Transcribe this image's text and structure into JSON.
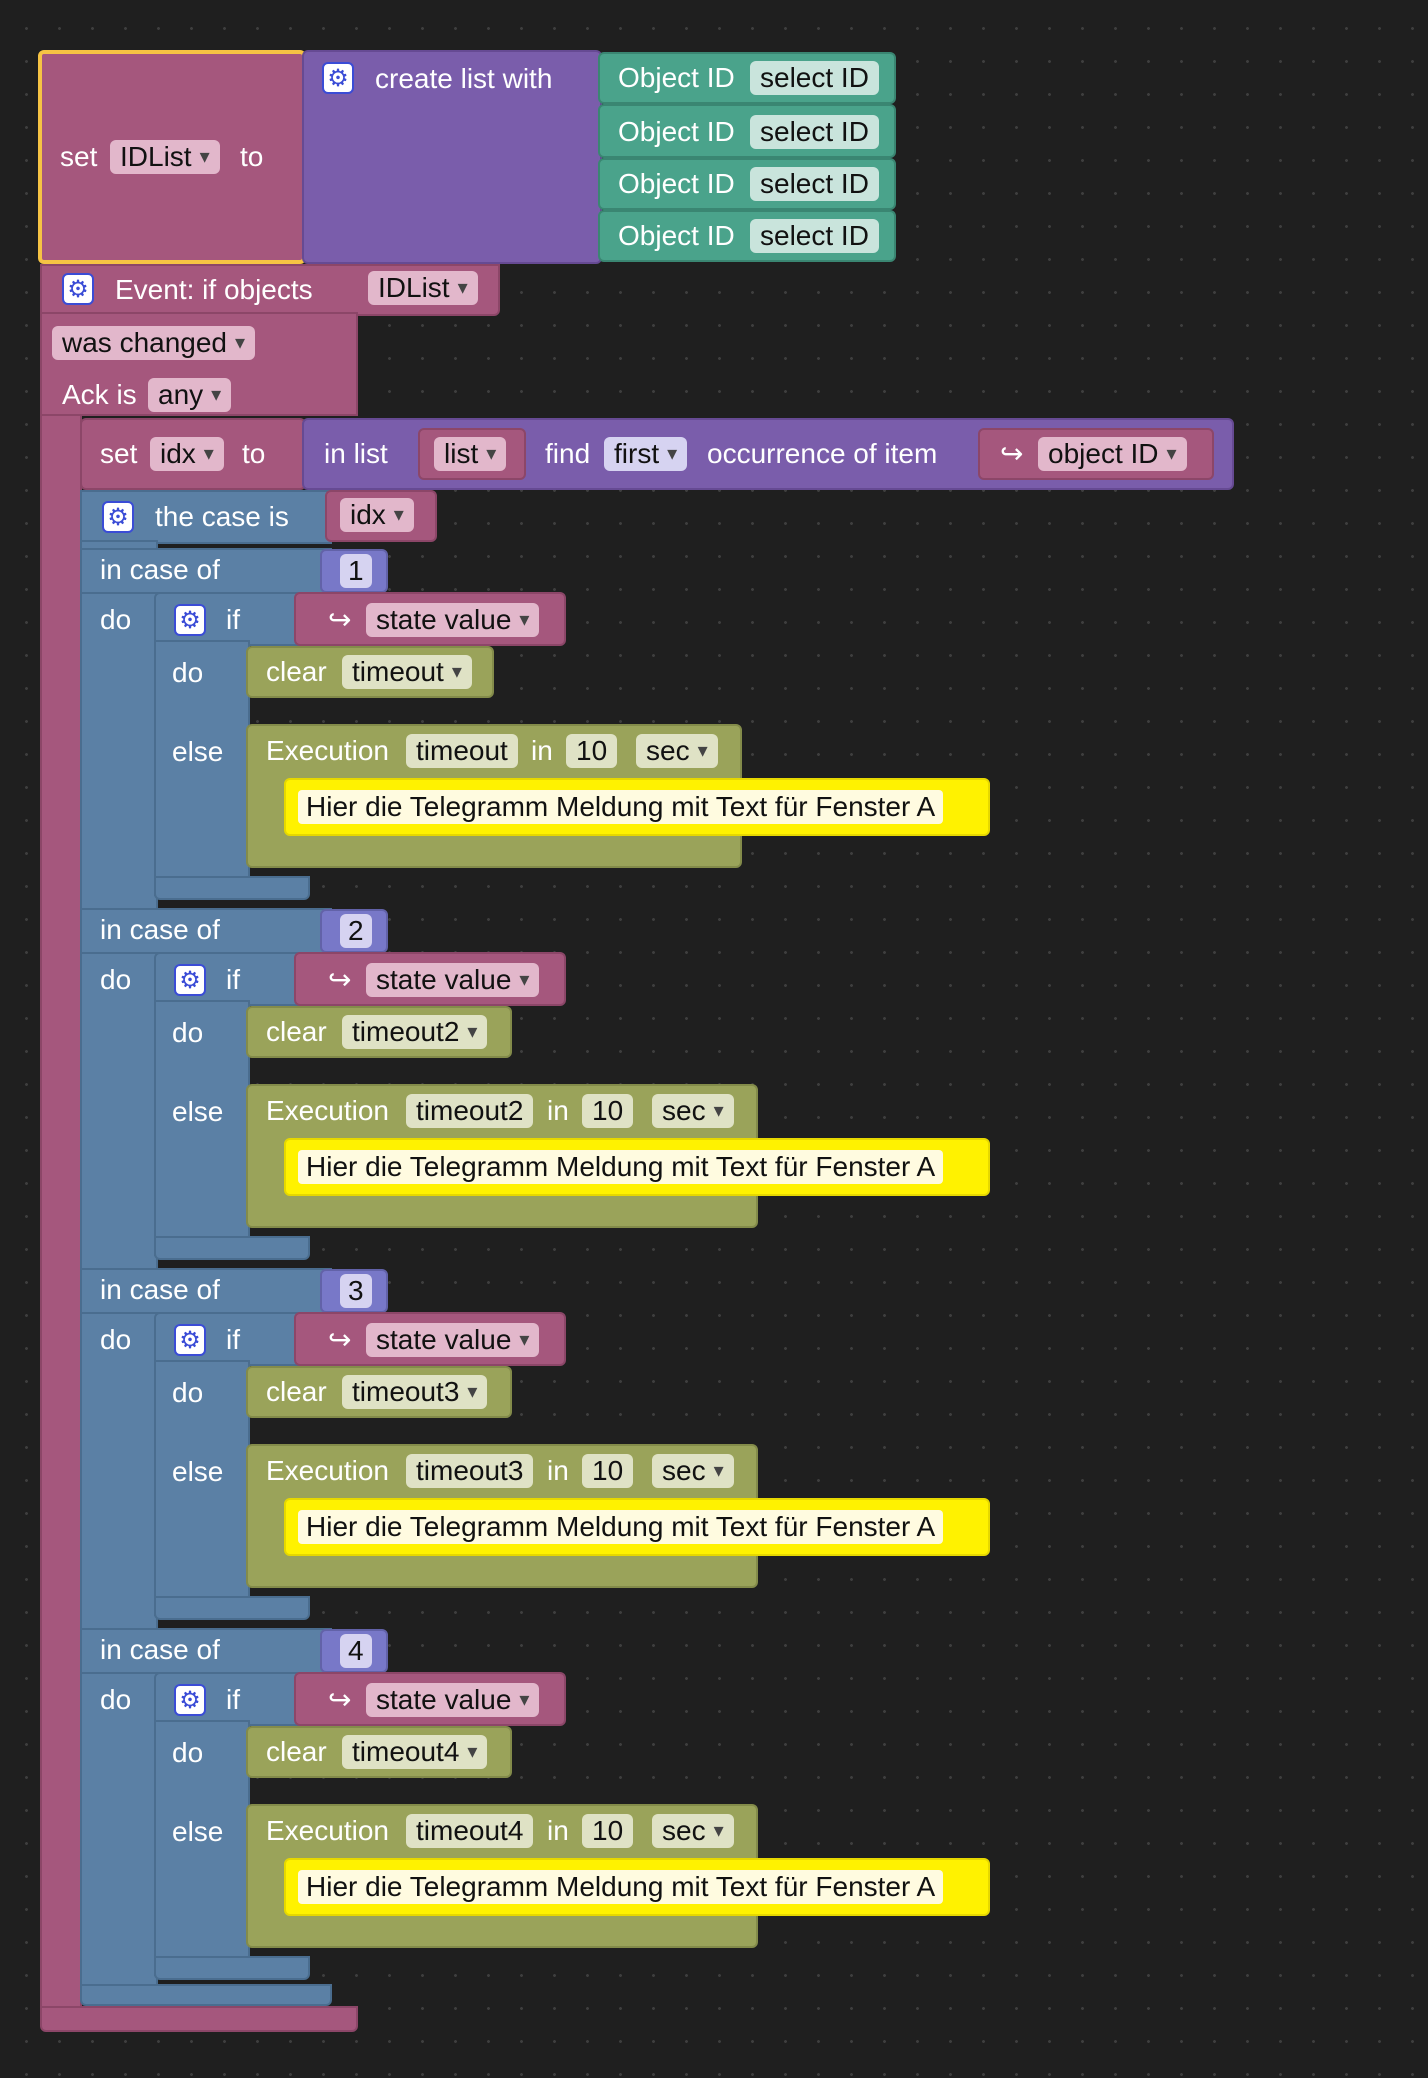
{
  "set_block": {
    "set": "set",
    "var": "IDList",
    "to": "to"
  },
  "create_list": {
    "label": "create list with"
  },
  "object_ids": [
    {
      "label": "Object ID",
      "value": "select ID"
    },
    {
      "label": "Object ID",
      "value": "select ID"
    },
    {
      "label": "Object ID",
      "value": "select ID"
    },
    {
      "label": "Object ID",
      "value": "select ID"
    }
  ],
  "event": {
    "label": "Event: if objects",
    "var": "IDList",
    "trigger": "was changed",
    "ack_label": "Ack is",
    "ack_value": "any"
  },
  "set_idx": {
    "set": "set",
    "var": "idx",
    "to": "to",
    "in_list": "in list",
    "list_var": "list",
    "find": "find",
    "find_mode": "first",
    "occurrence": "occurrence of item",
    "item": "object ID"
  },
  "switch": {
    "label": "the case is",
    "var": "idx"
  },
  "cases": [
    {
      "in_case": "in case of",
      "num": "1",
      "do": "do",
      "if": "if",
      "cond": "state value",
      "do2": "do",
      "clear": "clear",
      "timeout": "timeout",
      "else": "else",
      "exec": "Execution",
      "exec_var": "timeout",
      "in": "in",
      "delay": "10",
      "unit": "sec",
      "message": "Hier die Telegramm Meldung mit Text für Fenster A"
    },
    {
      "in_case": "in case of",
      "num": "2",
      "do": "do",
      "if": "if",
      "cond": "state value",
      "do2": "do",
      "clear": "clear",
      "timeout": "timeout2",
      "else": "else",
      "exec": "Execution",
      "exec_var": "timeout2",
      "in": "in",
      "delay": "10",
      "unit": "sec",
      "message": "Hier die Telegramm Meldung mit Text für Fenster A"
    },
    {
      "in_case": "in case of",
      "num": "3",
      "do": "do",
      "if": "if",
      "cond": "state value",
      "do2": "do",
      "clear": "clear",
      "timeout": "timeout3",
      "else": "else",
      "exec": "Execution",
      "exec_var": "timeout3",
      "in": "in",
      "delay": "10",
      "unit": "sec",
      "message": "Hier die Telegramm Meldung mit Text für Fenster A"
    },
    {
      "in_case": "in case of",
      "num": "4",
      "do": "do",
      "if": "if",
      "cond": "state value",
      "do2": "do",
      "clear": "clear",
      "timeout": "timeout4",
      "else": "else",
      "exec": "Execution",
      "exec_var": "timeout4",
      "in": "in",
      "delay": "10",
      "unit": "sec",
      "message": "Hier die Telegramm Meldung mit Text für Fenster A"
    }
  ],
  "colors": {
    "background": "#1f1f1f",
    "magenta": "#a5577d",
    "purple": "#7a5dab",
    "green": "#4aa38b",
    "blue": "#5b80a5",
    "olive": "#9aa35a",
    "yellow": "#fff200",
    "selection": "#f6c344"
  },
  "icons": {
    "gear": "gear-icon",
    "dropdown": "chevron-down-icon",
    "return_arrow": "return-arrow-icon"
  }
}
